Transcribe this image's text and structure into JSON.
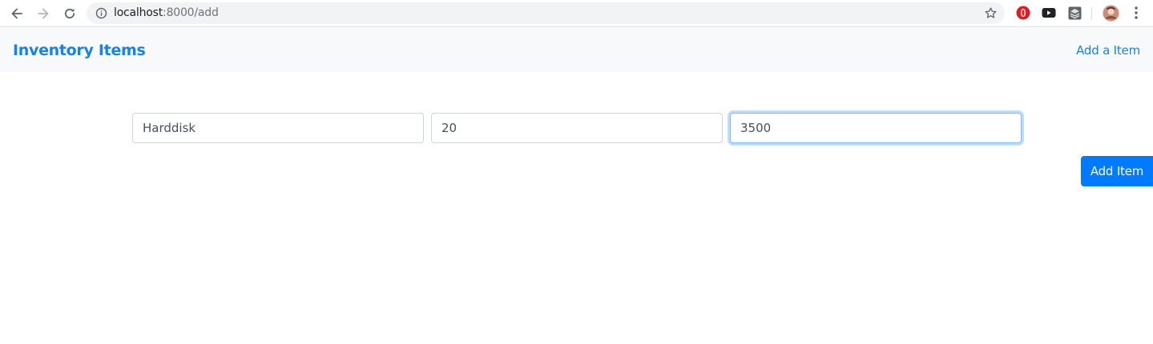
{
  "browser": {
    "url_host": "localhost",
    "url_path": ":8000/add"
  },
  "navbar": {
    "brand": "Inventory Items",
    "link": "Add a Item"
  },
  "form": {
    "name_value": "Harddisk",
    "quantity_value": "20",
    "price_value": "3500",
    "submit_label": "Add Item"
  },
  "colors": {
    "accent": "#007bff",
    "brand": "#1a82e2",
    "navbar_bg": "#f8f9fa"
  },
  "icons": [
    "back-arrow-icon",
    "forward-arrow-icon",
    "reload-icon",
    "info-icon",
    "star-icon",
    "opera-icon",
    "youtube-icon",
    "extension-icon",
    "profile-avatar",
    "menu-dots-icon"
  ]
}
